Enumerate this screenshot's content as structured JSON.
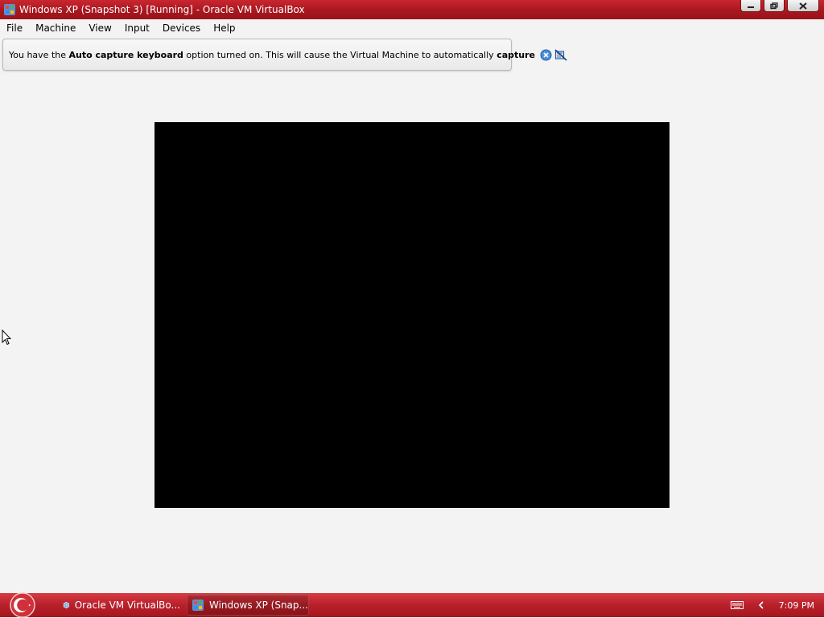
{
  "window": {
    "title": "Windows XP (Snapshot 3) [Running] - Oracle VM VirtualBox"
  },
  "menubar": {
    "items": [
      "File",
      "Machine",
      "View",
      "Input",
      "Devices",
      "Help"
    ]
  },
  "notice": {
    "part1": "You have the ",
    "bold1": "Auto capture keyboard",
    "part2": " option turned on. This will cause the Virtual Machine to automatically ",
    "bold2": "capture"
  },
  "taskbar": {
    "items": [
      {
        "label": "Oracle VM VirtualBo...",
        "icon": "virtualbox-icon"
      },
      {
        "label": "Windows XP (Snap...",
        "icon": "windows-xp-vm-icon"
      }
    ],
    "clock": "7:09 PM"
  },
  "colors": {
    "titlebar": "#b01c24",
    "taskbar": "#b7202a",
    "background": "#f3f3f3",
    "vm_screen": "#000000"
  }
}
